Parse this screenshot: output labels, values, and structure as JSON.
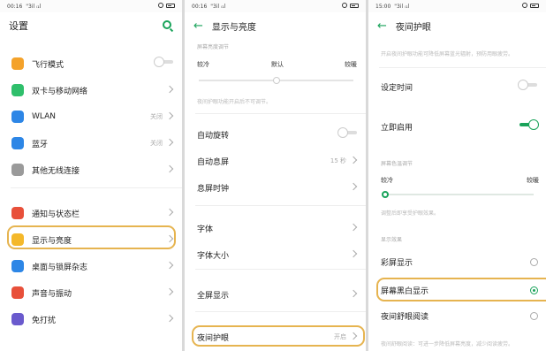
{
  "panel1": {
    "status": {
      "time": "00:16",
      "signal": "\"3il ᵢ₁l"
    },
    "title": "设置",
    "items": [
      {
        "label": "飞行模式",
        "icon": "airplane-icon",
        "color": "#f4a22a",
        "control": "toggle"
      },
      {
        "label": "双卡与移动网络",
        "icon": "sim-card-icon",
        "color": "#2fbf6b",
        "control": "chevron"
      },
      {
        "label": "WLAN",
        "icon": "wifi-icon",
        "color": "#2d86e6",
        "value": "关闭",
        "control": "chevron"
      },
      {
        "label": "蓝牙",
        "icon": "bluetooth-icon",
        "color": "#2d86e6",
        "value": "关闭",
        "control": "chevron"
      },
      {
        "label": "其他无线连接",
        "icon": "wireless-icon",
        "color": "#9a9a9a",
        "control": "chevron"
      },
      {
        "label": "通知与状态栏",
        "icon": "notification-icon",
        "color": "#e8503a",
        "control": "chevron"
      },
      {
        "label": "显示与亮度",
        "icon": "brightness-icon",
        "color": "#f4b82a",
        "control": "chevron"
      },
      {
        "label": "桌面与锁屏杂志",
        "icon": "wallpaper-icon",
        "color": "#2d86e6",
        "control": "chevron"
      },
      {
        "label": "声音与振动",
        "icon": "sound-icon",
        "color": "#e8503a",
        "control": "chevron"
      },
      {
        "label": "免打扰",
        "icon": "moon-icon",
        "color": "#6a5acd",
        "control": "chevron"
      }
    ]
  },
  "panel2": {
    "status": {
      "time": "00:16",
      "signal": "\"3il ᵢ₁l"
    },
    "title": "显示与亮度",
    "brightness_header": "屏幕亮度调节",
    "slider_labels": {
      "left": "较冷",
      "mid": "默认",
      "right": "较暖"
    },
    "slider_level": 0.5,
    "slider_note": "夜间护眼功能开启后不可调节。",
    "items": [
      {
        "label": "自动旋转",
        "control": "toggle"
      },
      {
        "label": "自动息屏",
        "value": "15 秒",
        "control": "chevron"
      },
      {
        "label": "息屏时钟",
        "control": "chevron"
      },
      {
        "label": "字体",
        "control": "chevron"
      },
      {
        "label": "字体大小",
        "control": "chevron"
      },
      {
        "label": "全屏显示",
        "control": "chevron"
      },
      {
        "label": "夜间护眼",
        "value": "开启",
        "control": "chevron"
      }
    ]
  },
  "panel3": {
    "status": {
      "time": "15:00",
      "signal": "\"3il ᵢ₁l"
    },
    "title": "夜间护眼",
    "intro": "开启夜间护眼功能可降低屏幕蓝光辐射，预防用眼疲劳。",
    "items_top": [
      {
        "label": "设定时间",
        "control": "toggle",
        "on": false
      },
      {
        "label": "立即启用",
        "control": "toggle",
        "on": true
      }
    ],
    "temp_header": "屏幕色温调节",
    "slider_labels": {
      "left": "较冷",
      "right": "较暖"
    },
    "slider_level": 0.02,
    "temp_note": "调整后即享受护眼效果。",
    "mode_header": "显示效果",
    "modes": [
      {
        "label": "彩屏显示",
        "selected": false
      },
      {
        "label": "屏幕黑白显示",
        "selected": true
      },
      {
        "label": "夜间舒眼阅读",
        "selected": false
      }
    ],
    "footer_note": "夜间舒眼阅读：可进一步降低屏幕亮度，减少阅读疲劳。"
  },
  "colors": {
    "accent": "#19a35a",
    "highlight": "#e6b450"
  }
}
